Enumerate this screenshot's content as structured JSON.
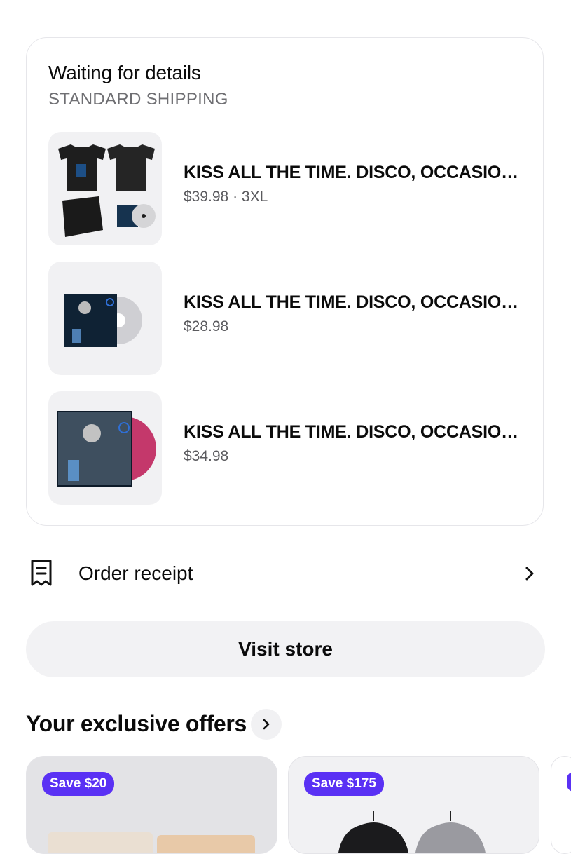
{
  "order": {
    "status_title": "Waiting for details",
    "shipping_method": "STANDARD SHIPPING",
    "items": [
      {
        "title": "KISS ALL THE TIME. DISCO, OCCASIONALLY.",
        "meta": "$39.98 · 3XL"
      },
      {
        "title": "KISS ALL THE TIME. DISCO, OCCASIONALLY.",
        "meta": "$28.98"
      },
      {
        "title": "KISS ALL THE TIME. DISCO, OCCASIONALLY.",
        "meta": "$34.98"
      }
    ]
  },
  "receipt": {
    "label": "Order receipt",
    "icon": "receipt-icon"
  },
  "visit_store": {
    "label": "Visit store"
  },
  "offers": {
    "title": "Your exclusive offers",
    "cards": [
      {
        "badge": "Save $20"
      },
      {
        "badge": "Save $175"
      }
    ]
  },
  "colors": {
    "accent": "#5a31f4",
    "card_bg": "#f1f1f3",
    "muted_text": "#6f6f73"
  }
}
